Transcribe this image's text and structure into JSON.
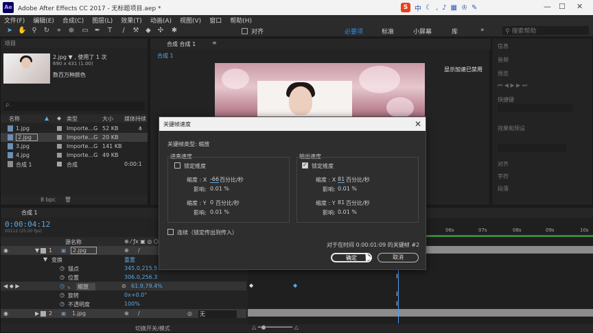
{
  "window": {
    "title": "Adobe After Effects CC 2017 - 无标题项目.aep *",
    "app_badge": "Ae"
  },
  "ime": {
    "logo": "S",
    "mode": "中",
    "icons": [
      "moon-icon",
      "comma",
      "mic-icon",
      "keyboard-icon",
      "shirt-icon",
      "wrench-icon"
    ]
  },
  "menu": [
    "文件(F)",
    "编辑(E)",
    "合成(C)",
    "图层(L)",
    "效果(T)",
    "动画(A)",
    "视图(V)",
    "窗口",
    "帮助(H)"
  ],
  "toolbar": {
    "snap_label": "对齐",
    "workspaces": [
      "必要项",
      "标准",
      "小屏幕",
      "库"
    ],
    "active_workspace": "必要项",
    "search_placeholder": "搜索帮助"
  },
  "project": {
    "tab": "项目",
    "item_name": "2.jpg ▼ , 使用了 1 次",
    "item_dims": "690 x 431 (1.00)",
    "item_colors": "数百万种颜色",
    "search_placeholder": "ρ.",
    "columns": [
      "名称",
      "类型",
      "大小",
      "媒体持续"
    ],
    "rows": [
      {
        "name": "1.jpg",
        "type": "Importe...G",
        "size": "52 KB",
        "dur": ""
      },
      {
        "name": "2.jpg",
        "type": "Importe...G",
        "size": "20 KB",
        "dur": ""
      },
      {
        "name": "3.jpg",
        "type": "Importe...G",
        "size": "141 KB",
        "dur": ""
      },
      {
        "name": "4.jpg",
        "type": "Importe...G",
        "size": "49 KB",
        "dur": ""
      },
      {
        "name": "合成 1",
        "type": "合成",
        "size": "",
        "dur": "0:00:1"
      }
    ],
    "bpc": "8 bpc"
  },
  "viewer": {
    "tab": "合成 合成 1",
    "subtab": "合成 1",
    "gpu_notice": "显示加速已禁用"
  },
  "right_panel": {
    "labels": [
      "信息",
      "音频",
      "预览",
      "快捷键",
      "效果和预设",
      "对齐",
      "字符",
      "段落"
    ]
  },
  "dialog": {
    "title": "关键帧速度",
    "keyframe_type": "关键帧类型: 缩放",
    "incoming": {
      "label": "进来速度",
      "lock_label": "锁定维度",
      "locked": false,
      "x_label": "缩度 : X",
      "x_value": "-66",
      "x_unit": "百分比/秒",
      "x_influence_label": "影响:",
      "x_influence": "0.01 %",
      "y_label": "缩度 : Y",
      "y_value": "0",
      "y_unit": "百分比/秒",
      "y_influence_label": "影响:",
      "y_influence": "0.01 %"
    },
    "outgoing": {
      "label": "输出速度",
      "lock_label": "锁定维度",
      "locked": true,
      "x_label": "缩度 : X",
      "x_value": "81",
      "x_unit": "百分比/秒",
      "x_influence_label": "影响:",
      "x_influence": "0.01 %",
      "y_label": "缩度 : Y",
      "y_value": "81",
      "y_unit": "百分比/秒",
      "y_influence_label": "影响:",
      "y_influence": "0.01 %"
    },
    "continuous_label": "连续（锁定传出到传入）",
    "status": "对于在时间 0:00:01:09 的关键帧 #2",
    "ok": "确定",
    "cancel": "取消"
  },
  "timeline": {
    "tab": "合成 1",
    "timecode": "0:00:04:12",
    "fps": "00112 (25.00 fps)",
    "source_col": "源名称",
    "ruler": [
      "06s",
      "07s",
      "08s",
      "09s",
      "10s"
    ],
    "layers": [
      {
        "num": "1",
        "name": "2.jpg"
      },
      {
        "num": "2",
        "name": "1.jpg"
      }
    ],
    "transform_label": "变换",
    "reset_label": "重置",
    "props": [
      {
        "name": "锚点",
        "value": "345.0,215.5"
      },
      {
        "name": "位置",
        "value": "306.0,256.3"
      },
      {
        "name": "缩放",
        "value": "61.9,79.4%"
      },
      {
        "name": "旋转",
        "value": "0x+0.0°"
      },
      {
        "name": "不透明度",
        "value": "100%"
      }
    ],
    "parent_none": "无",
    "footer_label": "切换开关/模式"
  }
}
